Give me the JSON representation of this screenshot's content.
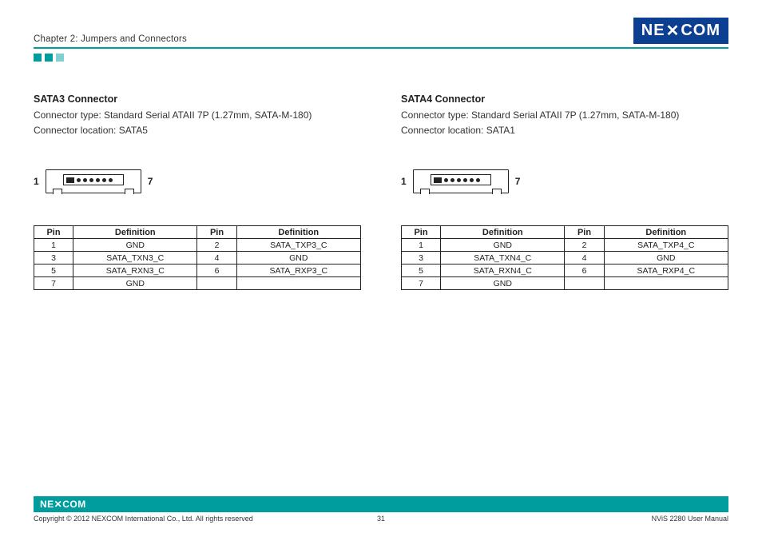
{
  "header": {
    "chapter": "Chapter 2: Jumpers and Connectors",
    "logo_text": "NEXCOM"
  },
  "left": {
    "title": "SATA3 Connector",
    "type_line": "Connector type: Standard Serial ATAII 7P (1.27mm, SATA-M-180)",
    "loc_line": "Connector location: SATA5",
    "pin_left_label": "1",
    "pin_right_label": "7",
    "table": {
      "headers": [
        "Pin",
        "Definition",
        "Pin",
        "Definition"
      ],
      "rows": [
        [
          "1",
          "GND",
          "2",
          "SATA_TXP3_C"
        ],
        [
          "3",
          "SATA_TXN3_C",
          "4",
          "GND"
        ],
        [
          "5",
          "SATA_RXN3_C",
          "6",
          "SATA_RXP3_C"
        ],
        [
          "7",
          "GND",
          "",
          ""
        ]
      ]
    }
  },
  "right": {
    "title": "SATA4 Connector",
    "type_line": "Connector type: Standard Serial ATAII 7P (1.27mm, SATA-M-180)",
    "loc_line": "Connector location: SATA1",
    "pin_left_label": "1",
    "pin_right_label": "7",
    "table": {
      "headers": [
        "Pin",
        "Definition",
        "Pin",
        "Definition"
      ],
      "rows": [
        [
          "1",
          "GND",
          "2",
          "SATA_TXP4_C"
        ],
        [
          "3",
          "SATA_TXN4_C",
          "4",
          "GND"
        ],
        [
          "5",
          "SATA_RXN4_C",
          "6",
          "SATA_RXP4_C"
        ],
        [
          "7",
          "GND",
          "",
          ""
        ]
      ]
    }
  },
  "footer": {
    "logo_text": "NEXCOM",
    "copyright": "Copyright © 2012 NEXCOM International Co., Ltd. All rights reserved",
    "page": "31",
    "doc": "NViS 2280 User Manual"
  }
}
